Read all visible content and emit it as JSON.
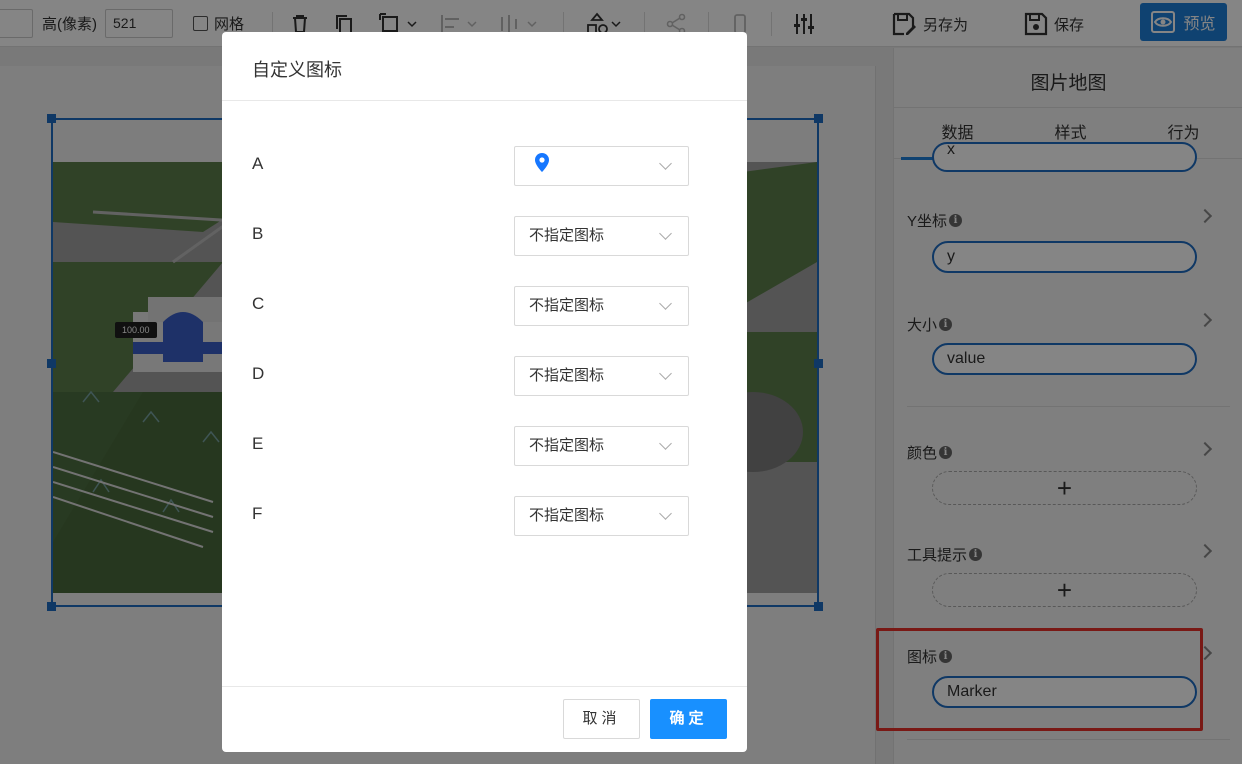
{
  "toolbar": {
    "height_label": "高(像素)",
    "height_value": "521",
    "grid_label": "网格",
    "save_as_label": "另存为",
    "save_label": "保存",
    "preview_label": "预览"
  },
  "canvas": {
    "value_tag": "100.00"
  },
  "panel": {
    "title": "图片地图",
    "tabs": [
      {
        "label": "数据",
        "active": true
      },
      {
        "label": "样式",
        "active": false
      },
      {
        "label": "行为",
        "active": false
      }
    ],
    "x_pill_partial": "x",
    "y_label": "Y坐标",
    "y_value": "y",
    "size_label": "大小",
    "size_value": "value",
    "color_label": "颜色",
    "color_add": "+",
    "tooltip_label": "工具提示",
    "tooltip_add": "+",
    "icon_label": "图标",
    "icon_value": "Marker",
    "info_glyph": "i"
  },
  "modal": {
    "title": "自定义图标",
    "rows": [
      {
        "label": "A",
        "value": "",
        "icon": "map-pin-icon"
      },
      {
        "label": "B",
        "value": "不指定图标"
      },
      {
        "label": "C",
        "value": "不指定图标"
      },
      {
        "label": "D",
        "value": "不指定图标"
      },
      {
        "label": "E",
        "value": "不指定图标"
      },
      {
        "label": "F",
        "value": "不指定图标"
      }
    ],
    "cancel_label": "取消",
    "ok_label": "确定"
  },
  "colors": {
    "accent": "#1890ff",
    "selection": "#1e6bc2",
    "highlight": "#e8312a",
    "pin": "#1677ff"
  }
}
